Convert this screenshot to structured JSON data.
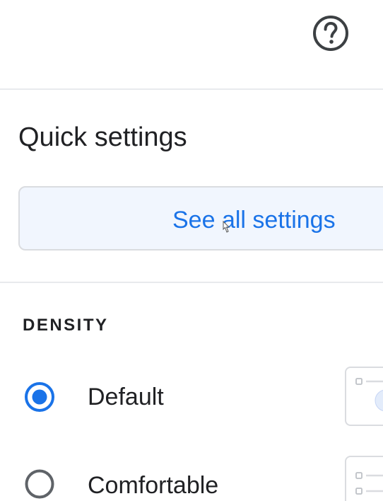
{
  "header": {
    "help_icon": "question-circle-icon"
  },
  "panel": {
    "title": "Quick settings",
    "see_all_label": "See all settings"
  },
  "density": {
    "heading": "DENSITY",
    "options": [
      {
        "label": "Default",
        "selected": true
      },
      {
        "label": "Comfortable",
        "selected": false
      }
    ]
  },
  "colors": {
    "accent": "#1a73e8",
    "button_bg": "#f1f6fe",
    "border": "#dadce0",
    "text": "#202124"
  }
}
